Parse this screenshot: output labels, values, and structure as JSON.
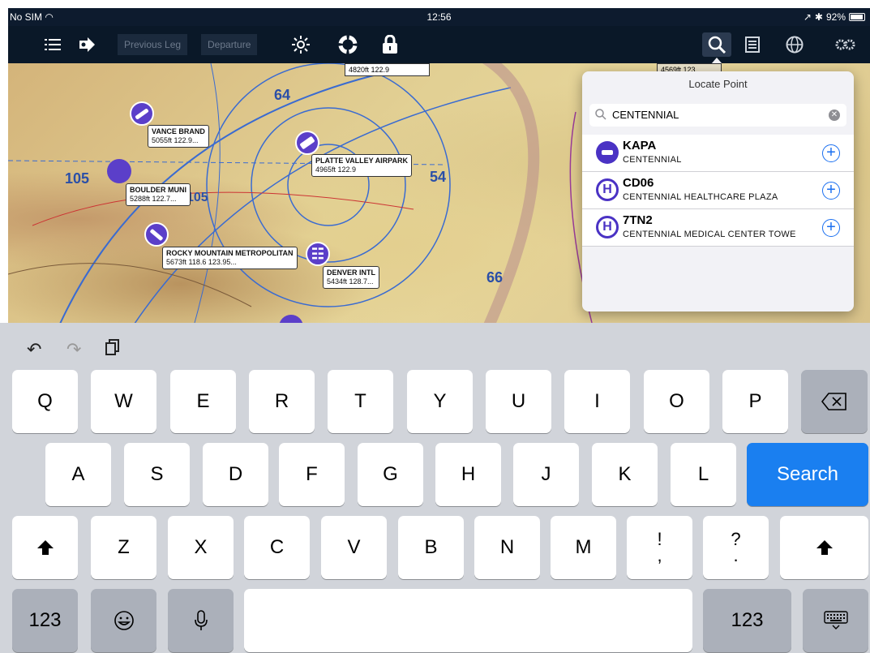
{
  "status_bar": {
    "carrier": "No SIM",
    "time": "12:56",
    "battery_text": "92%",
    "battery_level": 0.92
  },
  "toolbar": {
    "previous_leg_label": "Previous Leg",
    "departure_label": "Departure"
  },
  "map": {
    "airports": [
      {
        "name": "VANCE BRAND",
        "detail": "5055ft 122.9..."
      },
      {
        "name": "BOULDER MUNI",
        "detail": "5288ft 122.7..."
      },
      {
        "name": "ROCKY MOUNTAIN METROPOLITAN",
        "detail": "5673ft        118.6 123.95..."
      },
      {
        "name": "PLATTE VALLEY AIRPARK",
        "detail": "4965ft           122.9"
      },
      {
        "name": "DENVER INTL",
        "detail": "5434ft 128.7..."
      }
    ],
    "top_box": "4820ft        122.9",
    "top_right_box": "4569ft   123"
  },
  "locate_point": {
    "title": "Locate Point",
    "search_value": "CENTENNIAL",
    "results": [
      {
        "code": "KAPA",
        "name": "CENTENNIAL",
        "icon": "airport-runway-icon"
      },
      {
        "code": "CD06",
        "name": "CENTENNIAL HEALTHCARE PLAZA",
        "icon": "heliport-icon",
        "glyph": "H"
      },
      {
        "code": "7TN2",
        "name": "CENTENNIAL MEDICAL CENTER TOWE",
        "icon": "heliport-icon",
        "glyph": "H"
      }
    ]
  },
  "keyboard": {
    "row1": [
      "Q",
      "W",
      "E",
      "R",
      "T",
      "Y",
      "U",
      "I",
      "O",
      "P"
    ],
    "row2": [
      "A",
      "S",
      "D",
      "F",
      "G",
      "H",
      "J",
      "K",
      "L"
    ],
    "row3": [
      "Z",
      "X",
      "C",
      "V",
      "B",
      "N",
      "M"
    ],
    "punct1": [
      "!",
      ","
    ],
    "punct2": [
      "?",
      "."
    ],
    "search_label": "Search",
    "numbers_label": "123"
  },
  "colors": {
    "accent": "#1a7ff0",
    "airport": "#5b3fc9",
    "toolbar": "#0a1828"
  }
}
